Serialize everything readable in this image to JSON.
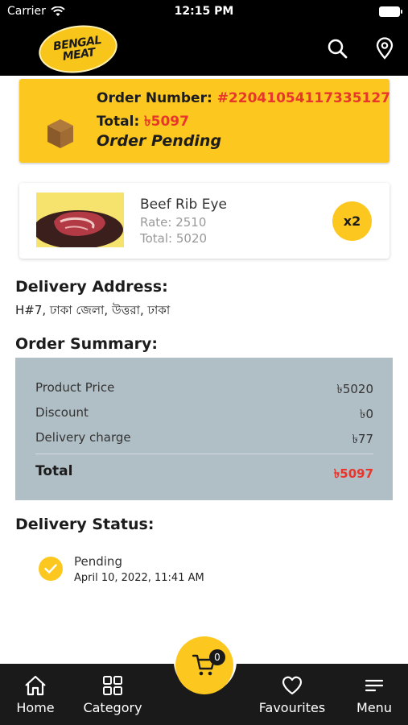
{
  "status_bar": {
    "carrier": "Carrier",
    "time": "12:15 PM"
  },
  "header": {
    "logo_line1": "BENGAL",
    "logo_line2": "MEAT",
    "search_icon": "search-icon",
    "location_icon": "location-pin-icon"
  },
  "order": {
    "number_label": "Order Number:",
    "number_value": "#22041054117335127",
    "total_label": "Total:",
    "total_value": "৳5097",
    "status": "Order Pending",
    "icon": "box-icon"
  },
  "product": {
    "name": "Beef Rib Eye",
    "rate": "Rate: 2510",
    "total": "Total: 5020",
    "quantity": "x2"
  },
  "delivery_address": {
    "title": "Delivery Address:",
    "text": "H#7, ঢাকা জেলা, উত্তরা, ঢাকা"
  },
  "order_summary": {
    "title": "Order Summary:",
    "rows": [
      {
        "label": "Product Price",
        "value": "৳5020"
      },
      {
        "label": "Discount",
        "value": "৳0"
      },
      {
        "label": "Delivery charge",
        "value": "৳77"
      }
    ],
    "total_label": "Total",
    "total_value": "৳5097"
  },
  "delivery_status": {
    "title": "Delivery Status:",
    "state": "Pending",
    "date": "April 10, 2022, 11:41 AM"
  },
  "bottom_nav": {
    "items": [
      {
        "label": "Home",
        "icon": "home-icon"
      },
      {
        "label": "Category",
        "icon": "grid-icon"
      },
      {
        "label": "Favourites",
        "icon": "heart-icon"
      },
      {
        "label": "Menu",
        "icon": "menu-icon"
      }
    ],
    "cart_count": "0"
  },
  "colors": {
    "accent": "#fcc820",
    "price_red": "#e8362c",
    "summary_bg": "#b0bec5",
    "bar_bg": "#1a1a1a"
  }
}
